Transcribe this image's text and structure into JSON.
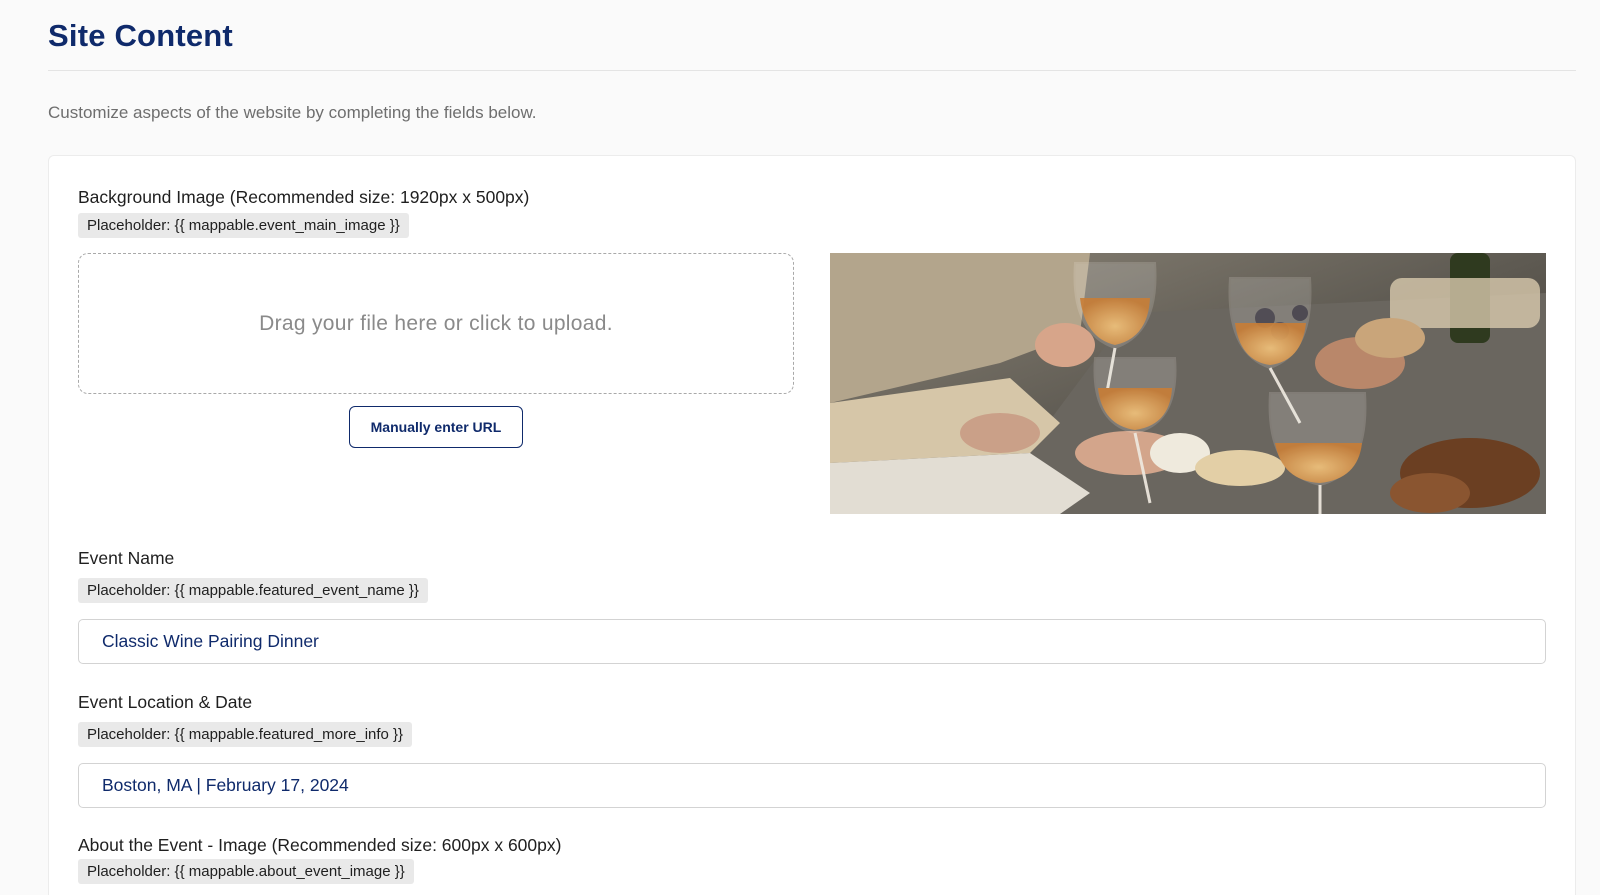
{
  "page": {
    "title": "Site Content",
    "intro": "Customize aspects of the website by completing the fields below."
  },
  "background_image": {
    "label": "Background Image (Recommended size: 1920px x 500px)",
    "placeholder": "Placeholder: {{ mappable.event_main_image }}",
    "dropzone_text": "Drag your file here or click to upload.",
    "url_button_label": "Manually enter URL",
    "preview_icon": "wine-glasses-toast-photo"
  },
  "event_name": {
    "label": "Event Name",
    "placeholder": "Placeholder: {{ mappable.featured_event_name }}",
    "value": "Classic Wine Pairing Dinner"
  },
  "event_location_date": {
    "label": "Event Location & Date",
    "placeholder": "Placeholder: {{ mappable.featured_more_info }}",
    "value": "Boston, MA | February 17, 2024"
  },
  "about_event_image": {
    "label": "About the Event - Image (Recommended size: 600px x 600px)",
    "placeholder": "Placeholder: {{ mappable.about_event_image }}"
  },
  "colors": {
    "primary": "#0f2a6b",
    "chip_background": "#e9e9e9",
    "muted_text": "#6e6e6e"
  }
}
